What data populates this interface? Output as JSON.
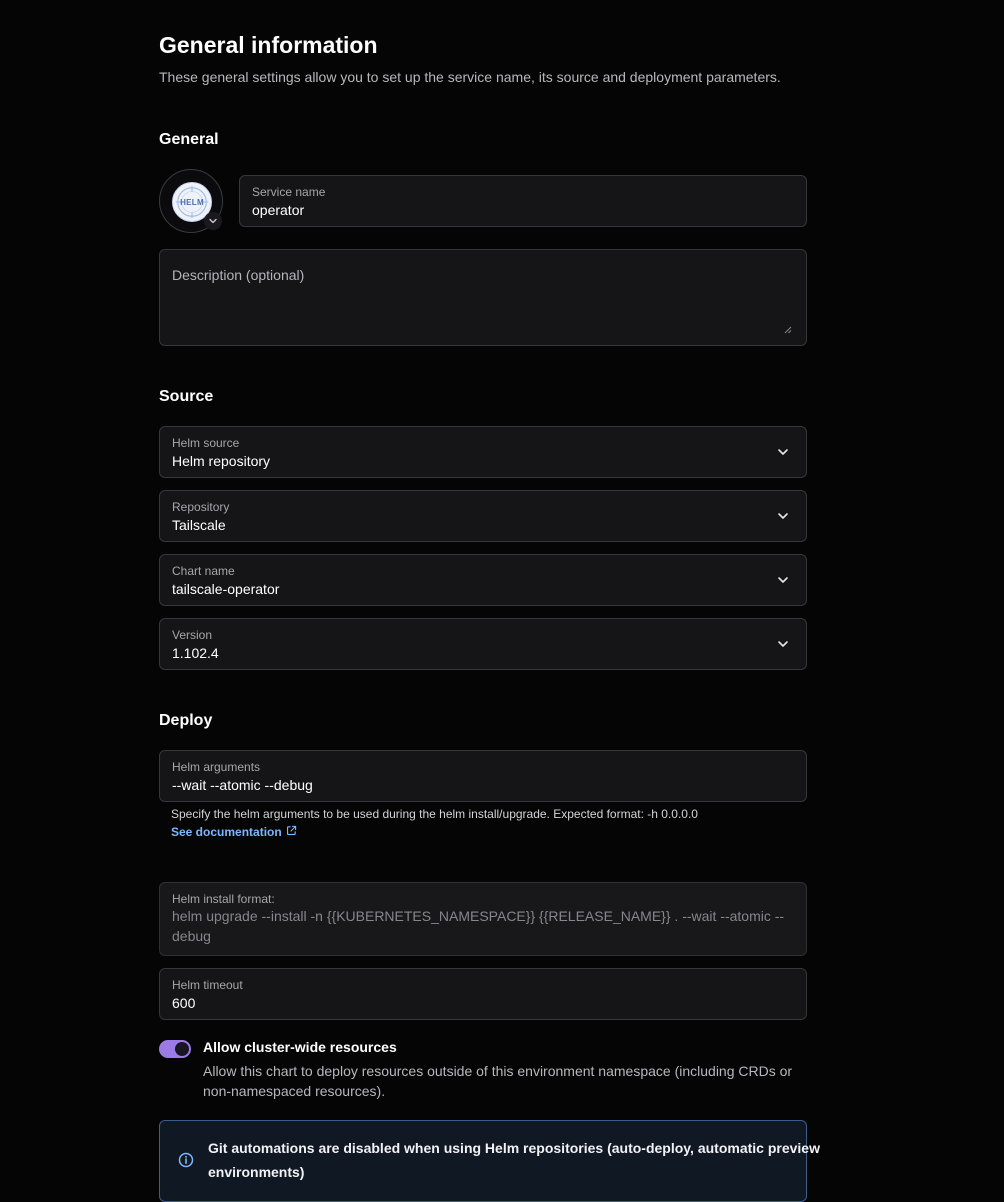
{
  "header": {
    "title": "General information",
    "subtitle": "These general settings allow you to set up the service name, its source and deployment parameters."
  },
  "general": {
    "section_title": "General",
    "avatar_text": "HELM",
    "service_name": {
      "label": "Service name",
      "value": "operator"
    },
    "description": {
      "placeholder": "Description (optional)"
    }
  },
  "source": {
    "section_title": "Source",
    "fields": [
      {
        "label": "Helm source",
        "value": "Helm repository"
      },
      {
        "label": "Repository",
        "value": "Tailscale"
      },
      {
        "label": "Chart name",
        "value": "tailscale-operator"
      },
      {
        "label": "Version",
        "value": "1.102.4"
      }
    ]
  },
  "deploy": {
    "section_title": "Deploy",
    "helm_arguments": {
      "label": "Helm arguments",
      "value": "--wait --atomic --debug"
    },
    "helper_text": "Specify the helm arguments to be used during the helm install/upgrade. Expected format: -h 0.0.0.0",
    "doc_link": "See documentation",
    "install_format": {
      "label": "Helm install format:",
      "line1": "helm upgrade --install -n {{KUBERNETES_NAMESPACE}} {{RELEASE_NAME}} . --wait --atomic --",
      "line2": "debug"
    },
    "helm_timeout": {
      "label": "Helm timeout",
      "value": "600"
    },
    "cluster_toggle": {
      "label": "Allow cluster-wide resources",
      "description_line1": "Allow this chart to deploy resources outside of this environment namespace (including CRDs or",
      "description_line2": "non-namespaced resources).",
      "enabled": true
    },
    "info_callout": {
      "line1": "Git automations are disabled when using Helm repositories (auto-deploy, automatic preview",
      "line2": "environments)"
    }
  },
  "colors": {
    "accent_toggle": "#9d7be6",
    "link": "#7cb7ff",
    "callout_border": "#3a5f8f",
    "field_bg": "#151518"
  }
}
